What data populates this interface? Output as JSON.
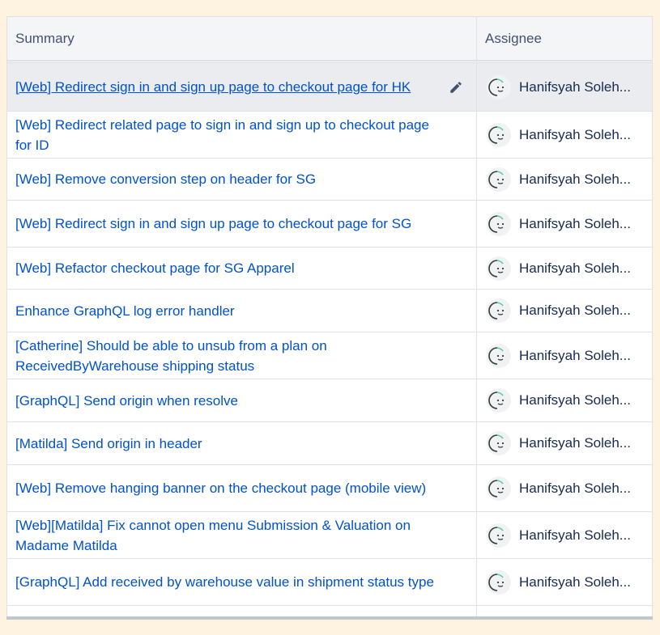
{
  "table": {
    "columns": {
      "summary": "Summary",
      "assignee": "Assignee"
    },
    "rows": [
      {
        "summary": "[Web] Redirect sign in and sign up page to checkout page for HK",
        "assignee": "Hanifsyah Soleh..."
      },
      {
        "summary": "[Web] Redirect related page to sign in and sign up to checkout page for ID",
        "assignee": "Hanifsyah Soleh..."
      },
      {
        "summary": "[Web] Remove conversion step on header for SG",
        "assignee": "Hanifsyah Soleh..."
      },
      {
        "summary": "[Web] Redirect sign in and sign up page to checkout page for SG",
        "assignee": "Hanifsyah Soleh..."
      },
      {
        "summary": "[Web] Refactor checkout page for SG Apparel",
        "assignee": "Hanifsyah Soleh..."
      },
      {
        "summary": "Enhance GraphQL log error handler",
        "assignee": "Hanifsyah Soleh..."
      },
      {
        "summary": "[Catherine] Should be able to unsub from a plan on ReceivedByWarehouse shipping status",
        "assignee": "Hanifsyah Soleh..."
      },
      {
        "summary": "[GraphQL] Send origin when resolve",
        "assignee": "Hanifsyah Soleh..."
      },
      {
        "summary": "[Matilda] Send origin in header",
        "assignee": "Hanifsyah Soleh..."
      },
      {
        "summary": "[Web] Remove hanging banner on the checkout page (mobile view)",
        "assignee": "Hanifsyah Soleh..."
      },
      {
        "summary": "[Web][Matilda] Fix cannot open menu Submission & Valuation on Madame Matilda",
        "assignee": "Hanifsyah Soleh..."
      },
      {
        "summary": "[GraphQL] Add received by warehouse value in shipment status type",
        "assignee": "Hanifsyah Soleh..."
      }
    ]
  },
  "icons": {
    "edit": "pencil-icon",
    "avatar": "avatar-face-icon"
  },
  "colors": {
    "link": "#0052cc",
    "header_bg": "#f4f5f7",
    "selected_row_bg": "#ebecf0",
    "page_bg": "#fdf3e0"
  }
}
